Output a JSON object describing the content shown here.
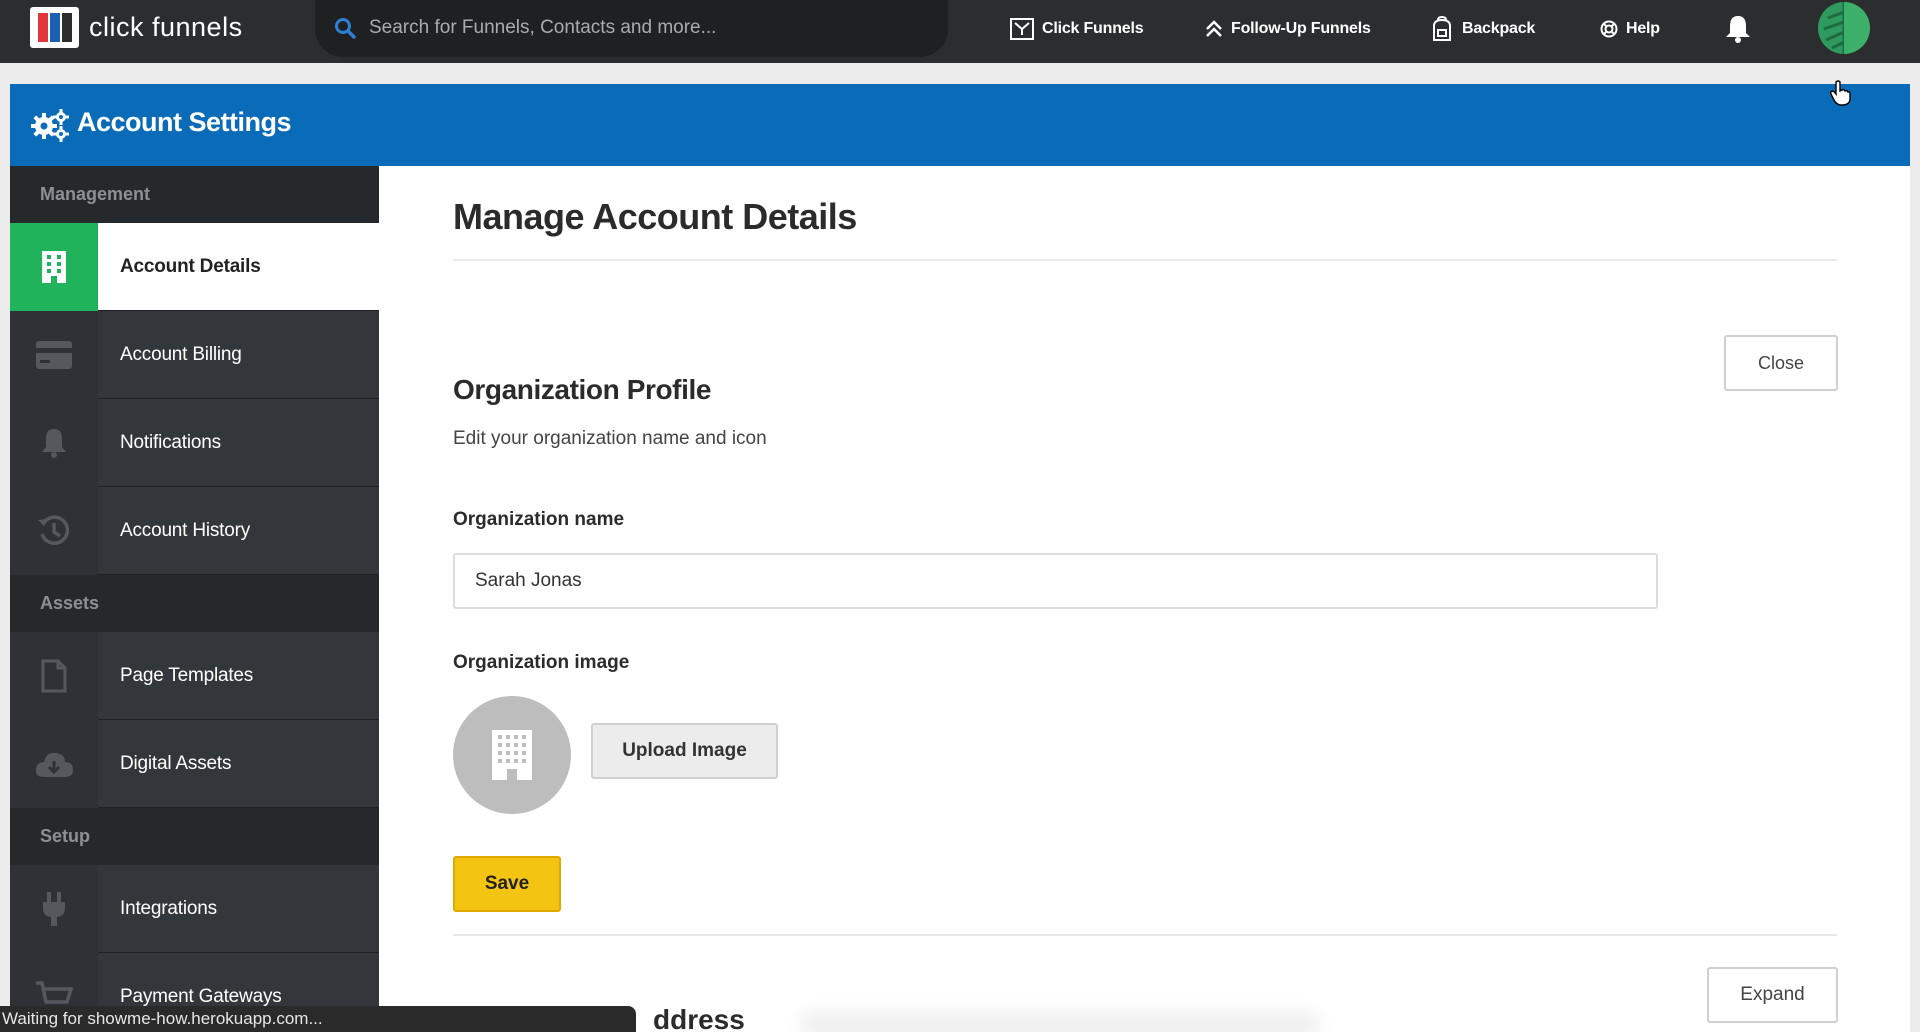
{
  "topnav": {
    "logo_text": "click funnels",
    "search_placeholder": "Search for Funnels, Contacts and more...",
    "links": [
      {
        "label": "Click Funnels",
        "icon": "clickfunnels-icon"
      },
      {
        "label": "Follow-Up Funnels",
        "icon": "chevrons-up-icon"
      },
      {
        "label": "Backpack",
        "icon": "backpack-icon"
      },
      {
        "label": "Help",
        "icon": "help-icon"
      }
    ]
  },
  "header": {
    "title": "Account Settings",
    "icon": "gears-icon",
    "color": "#0a6bb8"
  },
  "sidebar": {
    "sections": [
      {
        "label": "Management",
        "items": [
          {
            "label": "Account Details",
            "icon": "building-icon",
            "active": true
          },
          {
            "label": "Account Billing",
            "icon": "credit-card-icon"
          },
          {
            "label": "Notifications",
            "icon": "bell-icon"
          },
          {
            "label": "Account History",
            "icon": "history-icon"
          }
        ]
      },
      {
        "label": "Assets",
        "items": [
          {
            "label": "Page Templates",
            "icon": "file-icon"
          },
          {
            "label": "Digital Assets",
            "icon": "cloud-download-icon"
          }
        ]
      },
      {
        "label": "Setup",
        "items": [
          {
            "label": "Integrations",
            "icon": "plug-icon"
          },
          {
            "label": "Payment Gateways",
            "icon": "cart-icon"
          }
        ]
      }
    ],
    "active_color": "#21b35b"
  },
  "main": {
    "page_title": "Manage Account Details",
    "close_label": "Close",
    "section_title": "Organization Profile",
    "section_subtitle": "Edit your organization name and icon",
    "org_name_label": "Organization name",
    "org_name_value": "Sarah Jonas",
    "org_image_label": "Organization image",
    "upload_label": "Upload Image",
    "save_label": "Save",
    "expand_label": "Expand",
    "next_section_partial": "ddress"
  },
  "statusbar": {
    "text": "Waiting for showme-how.herokuapp.com..."
  }
}
